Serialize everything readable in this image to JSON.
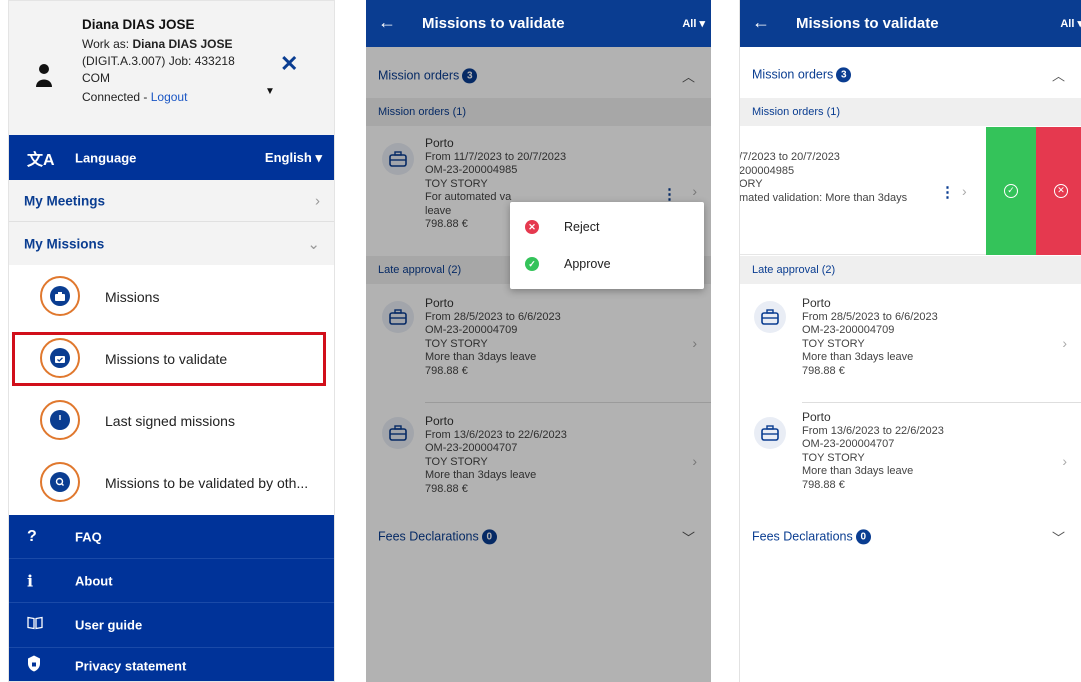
{
  "colors": {
    "primary": "#003399",
    "accent_orange": "#e0782e",
    "approve_green": "#34c35a",
    "reject_red": "#e5394f",
    "highlight_red": "#d10f1a"
  },
  "menu": {
    "user": {
      "name": "Diana DIAS JOSE",
      "work_as_prefix": "Work as: ",
      "work_as_name": "Diana DIAS JOSE",
      "org_line": "(DIGIT.A.3.007) Job: 433218",
      "org_line2": "COM",
      "connected": "Connected - ",
      "logout": "Logout",
      "avatar_icon": "person-icon",
      "close_icon": "close-icon"
    },
    "language": {
      "label": "Language",
      "value": "English",
      "icon": "translate-icon"
    },
    "my_meetings": "My Meetings",
    "my_missions": "My Missions",
    "mission_items": [
      {
        "label": "Missions",
        "icon": "briefcase-icon"
      },
      {
        "label": "Missions to validate",
        "icon": "briefcase-check-icon"
      },
      {
        "label": "Last signed missions",
        "icon": "timer-icon"
      },
      {
        "label": "Missions to be validated by oth...",
        "icon": "search-icon"
      }
    ],
    "footer_items": [
      {
        "label": "FAQ",
        "icon": "question-icon"
      },
      {
        "label": "About",
        "icon": "info-icon"
      },
      {
        "label": "User guide",
        "icon": "book-icon"
      },
      {
        "label": "Privacy statement",
        "icon": "lock-icon"
      }
    ]
  },
  "validate_page": {
    "title": "Missions to validate",
    "filter": "All",
    "mission_orders": {
      "label": "Mission orders",
      "count": "3"
    },
    "group_mission_orders": "Mission orders (1)",
    "group_late_approval": "Late approval (2)",
    "fees": {
      "label": "Fees Declarations",
      "count": "0"
    },
    "missions": [
      {
        "city": "Porto",
        "dates": "From 11/7/2023 to 20/7/2023",
        "ref": "OM-23-200004985",
        "project": "TOY STORY",
        "reason": "For automated validation: More than 3days",
        "reason_trunc": "For automated va",
        "reason_cont": "leave",
        "amount": "798.88 €"
      },
      {
        "city": "Porto",
        "dates": "From 28/5/2023 to 6/6/2023",
        "ref": "OM-23-200004709",
        "project": "TOY STORY",
        "reason": "More than 3days leave",
        "amount": "798.88 €"
      },
      {
        "city": "Porto",
        "dates": "From 13/6/2023 to 22/6/2023",
        "ref": "OM-23-200004707",
        "project": "TOY STORY",
        "reason": "More than 3days leave",
        "amount": "798.88 €"
      }
    ],
    "popup": {
      "reject": "Reject",
      "approve": "Approve"
    },
    "swipe": {
      "dates": "/7/2023 to 20/7/2023",
      "ref": "200004985",
      "project": "ORY",
      "reason": "mated validation: More than 3days",
      "approve_icon": "check-circle-icon",
      "reject_icon": "close-circle-icon"
    }
  }
}
